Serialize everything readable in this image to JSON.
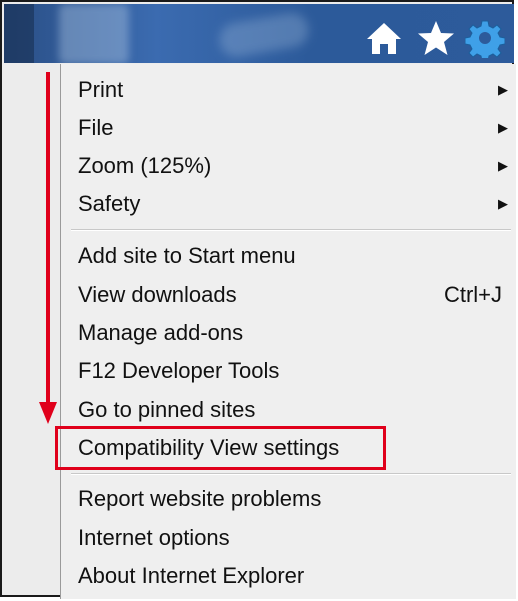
{
  "toolbar": {
    "icons": [
      "home-icon",
      "star-icon",
      "gear-icon"
    ]
  },
  "menu": {
    "groups": [
      [
        {
          "label": "Print",
          "submenu": true
        },
        {
          "label": "File",
          "submenu": true
        },
        {
          "label": "Zoom (125%)",
          "submenu": true
        },
        {
          "label": "Safety",
          "submenu": true
        }
      ],
      [
        {
          "label": "Add site to Start menu"
        },
        {
          "label": "View downloads",
          "shortcut": "Ctrl+J"
        },
        {
          "label": "Manage add-ons"
        },
        {
          "label": "F12 Developer Tools"
        },
        {
          "label": "Go to pinned sites"
        },
        {
          "label": "Compatibility View settings"
        }
      ],
      [
        {
          "label": "Report website problems"
        },
        {
          "label": "Internet options"
        },
        {
          "label": "About Internet Explorer"
        }
      ]
    ]
  },
  "annotation": {
    "highlight_color": "#e0001b",
    "highlighted_item": "Compatibility View settings"
  },
  "colors": {
    "toolbar_bg": "#2d5b9b",
    "menu_bg": "#efefef",
    "gear_accent": "#3fa0e8"
  }
}
